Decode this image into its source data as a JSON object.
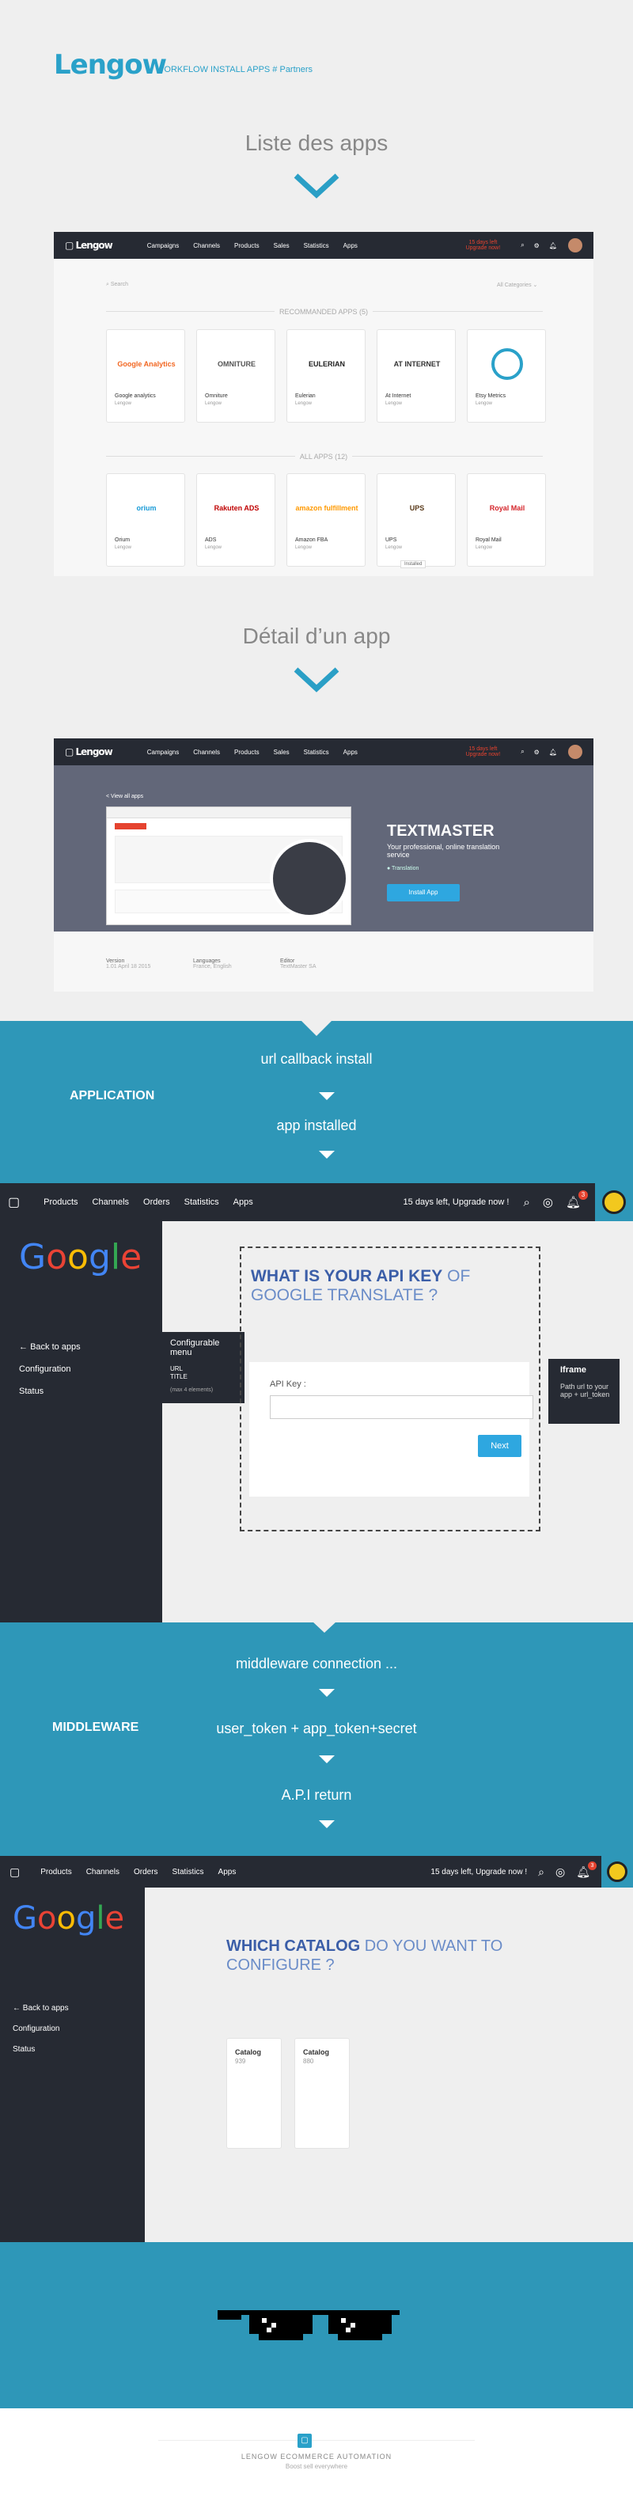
{
  "header": {
    "logo": "Lengow",
    "subtitle": "WORKFLOW INSTALL APPS # Partners"
  },
  "section1": {
    "title": "Liste des apps"
  },
  "app1": {
    "nav": [
      "Campaigns",
      "Channels",
      "Products",
      "Sales",
      "Statistics",
      "Apps"
    ],
    "trial": "15 days left",
    "upgrade": "Upgrade now!",
    "search": "Search",
    "filter": "All Categories",
    "recommended_label": "RECOMMANDED APPS (5)",
    "all_label": "ALL APPS (12)",
    "recommended": [
      {
        "name": "Google analytics",
        "by": "Lengow",
        "logo": "Google Analytics"
      },
      {
        "name": "Omniture",
        "by": "Lengow",
        "logo": "OMNITURE"
      },
      {
        "name": "Eulerian",
        "by": "Lengow",
        "logo": "EULERIAN"
      },
      {
        "name": "At Internet",
        "by": "Lengow",
        "logo": "AT INTERNET"
      },
      {
        "name": "Etsy Metrics",
        "by": "Lengow",
        "logo": ""
      }
    ],
    "all": [
      {
        "name": "Orium",
        "by": "Lengow",
        "logo": "orium"
      },
      {
        "name": "ADS",
        "by": "Lengow",
        "logo": "Rakuten ADS"
      },
      {
        "name": "Amazon FBA",
        "by": "Lengow",
        "logo": "amazon fulfillment"
      },
      {
        "name": "UPS",
        "by": "Lengow",
        "logo": "UPS"
      },
      {
        "name": "Royal Mail",
        "by": "Lengow",
        "logo": "Royal Mail"
      }
    ],
    "installed_badge": "Installed"
  },
  "section2": {
    "title": "Détail d’un app"
  },
  "app2": {
    "back": "< View all apps",
    "app_title": "TEXTMASTER",
    "desc": "Your professional, online translation service",
    "tag": "Translation",
    "install": "Install App",
    "meta": [
      {
        "k": "Version",
        "v": "1.01 April 18 2015"
      },
      {
        "k": "Languages",
        "v": "France, English"
      },
      {
        "k": "Editor",
        "v": "TextMaster SA"
      }
    ]
  },
  "flow1": {
    "label": "APPLICATION",
    "step1": "url callback install",
    "step2": "app installed"
  },
  "screen3": {
    "nav": [
      "Products",
      "Channels",
      "Orders",
      "Statistics",
      "Apps"
    ],
    "trial": "15 days left, Upgrade now !",
    "badge": "3",
    "google": "Google",
    "menu": [
      "Back to apps",
      "Configuration",
      "Status"
    ],
    "config_title": "Configurable menu",
    "config_items": [
      "URL",
      "TITLE"
    ],
    "config_note": "(max 4 elements)",
    "heading_bold": "WHAT IS YOUR API KEY",
    "heading_rest": " OF GOOGLE TRANSLATE ?",
    "api_label": "API Key :",
    "next": "Next",
    "iframe_title": "Iframe",
    "iframe_text": "Path url to your app + url_token"
  },
  "flow2": {
    "label": "MIDDLEWARE",
    "step1": "middleware connection ...",
    "step2": "user_token + app_token+secret",
    "step3": "A.P.I return"
  },
  "screen4": {
    "nav": [
      "Products",
      "Channels",
      "Orders",
      "Statistics",
      "Apps"
    ],
    "trial": "15 days left, Upgrade now !",
    "badge": "3",
    "google": "Google",
    "menu": [
      "Back to apps",
      "Configuration",
      "Status"
    ],
    "heading_bold": "WHICH CATALOG",
    "heading_rest": " DO YOU WANT TO CONFIGURE ?",
    "catalogs": [
      {
        "name": "Catalog",
        "count": "939"
      },
      {
        "name": "Catalog",
        "count": "880"
      }
    ]
  },
  "footer": {
    "line1": "LENGOW ECOMMERCE AUTOMATION",
    "line2": "Boost sell everywhere"
  },
  "colors": {
    "brand": "#2aa1c9",
    "dark": "#262a33",
    "blue": "#2e97b8",
    "accent": "#2ea7e0",
    "alert": "#e5432f"
  }
}
